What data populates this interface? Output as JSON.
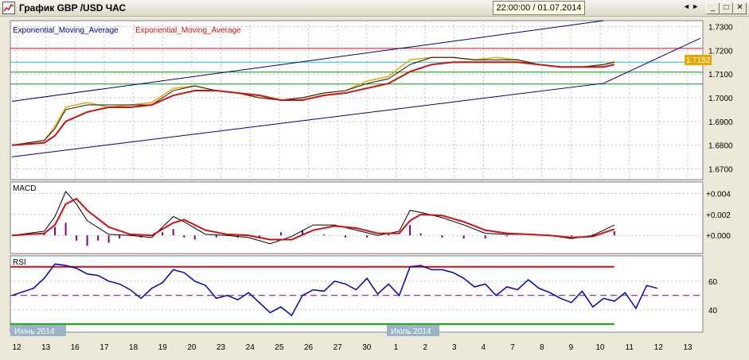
{
  "window": {
    "title": "График GBP /USD  ЧАС",
    "crosshair_time": "22:00:00 / 01.07.2014",
    "icons": {
      "app": "chart-app-icon",
      "minimize": "minimize-icon",
      "maximize": "maximize-icon",
      "close": "close-icon"
    },
    "buttons": {
      "minimize": "_",
      "maximize": "□",
      "close": "✕"
    },
    "nav_arrows": "◄ ►"
  },
  "colors": {
    "background": "#ffffff",
    "grid": "#c0c0c0",
    "price": "#e8a800",
    "ema_fast": "#1a1a1a",
    "ema_slow": "#d01010",
    "channel": "#000080",
    "resistance": "#d01010",
    "support": "#00a000",
    "cyan_level": "#20c0c0",
    "rsi_line": "#0000c0",
    "rsi_overbought": "#ff00ff",
    "macd_hist": "#800080",
    "current_price_label": "#e8a800"
  },
  "chart_data": [
    {
      "type": "line",
      "panel": "price",
      "legend": [
        "Exponential_Moving_Average",
        "Exponential_Moving_Average"
      ],
      "legend_colors": [
        "#000080",
        "#d01010"
      ],
      "ylim": [
        1.6665,
        1.7315
      ],
      "yticks": [
        "1.7300",
        "1.7200",
        "1.7100",
        "1.7000",
        "1.6900",
        "1.6800",
        "1.6700"
      ],
      "current_price": "1.7152",
      "hlines": {
        "resistance": 1.7208,
        "cyan": 1.715,
        "support_top": 1.7108,
        "support_bottom": 1.7058
      },
      "channel_upper": [
        [
          0,
          1.6985
        ],
        [
          55,
          1.7325
        ]
      ],
      "channel_lower": [
        [
          0,
          1.6751
        ],
        [
          55,
          1.7061
        ],
        [
          64,
          1.7251
        ]
      ],
      "price": [
        [
          0,
          1.68
        ],
        [
          3,
          1.682
        ],
        [
          4,
          1.688
        ],
        [
          5,
          1.696
        ],
        [
          7,
          1.698
        ],
        [
          9,
          1.696
        ],
        [
          11,
          1.697
        ],
        [
          13,
          1.698
        ],
        [
          15,
          1.704
        ],
        [
          17,
          1.705
        ],
        [
          19,
          1.703
        ],
        [
          21,
          1.702
        ],
        [
          23,
          1.7
        ],
        [
          25,
          1.699
        ],
        [
          27,
          1.7
        ],
        [
          29,
          1.702
        ],
        [
          31,
          1.703
        ],
        [
          33,
          1.707
        ],
        [
          35,
          1.709
        ],
        [
          37,
          1.716
        ],
        [
          39,
          1.717
        ],
        [
          41,
          1.717
        ],
        [
          43,
          1.716
        ],
        [
          45,
          1.717
        ],
        [
          47,
          1.716
        ],
        [
          49,
          1.714
        ],
        [
          51,
          1.713
        ],
        [
          53,
          1.713
        ],
        [
          55,
          1.714
        ],
        [
          56,
          1.7152
        ]
      ],
      "ema_fast": [
        [
          0,
          1.68
        ],
        [
          3,
          1.682
        ],
        [
          4,
          1.687
        ],
        [
          5,
          1.695
        ],
        [
          7,
          1.697
        ],
        [
          9,
          1.697
        ],
        [
          11,
          1.697
        ],
        [
          13,
          1.697
        ],
        [
          15,
          1.703
        ],
        [
          17,
          1.705
        ],
        [
          19,
          1.703
        ],
        [
          21,
          1.702
        ],
        [
          23,
          1.7
        ],
        [
          25,
          1.699
        ],
        [
          27,
          1.7
        ],
        [
          29,
          1.702
        ],
        [
          31,
          1.703
        ],
        [
          33,
          1.706
        ],
        [
          35,
          1.708
        ],
        [
          37,
          1.714
        ],
        [
          39,
          1.717
        ],
        [
          41,
          1.717
        ],
        [
          43,
          1.716
        ],
        [
          45,
          1.716
        ],
        [
          47,
          1.716
        ],
        [
          49,
          1.714
        ],
        [
          51,
          1.713
        ],
        [
          53,
          1.713
        ],
        [
          55,
          1.714
        ],
        [
          56,
          1.715
        ]
      ],
      "ema_slow": [
        [
          0,
          1.68
        ],
        [
          3,
          1.681
        ],
        [
          4,
          1.684
        ],
        [
          5,
          1.69
        ],
        [
          7,
          1.694
        ],
        [
          9,
          1.696
        ],
        [
          11,
          1.696
        ],
        [
          13,
          1.697
        ],
        [
          15,
          1.701
        ],
        [
          17,
          1.703
        ],
        [
          19,
          1.703
        ],
        [
          21,
          1.702
        ],
        [
          23,
          1.701
        ],
        [
          25,
          1.699
        ],
        [
          27,
          1.699
        ],
        [
          29,
          1.701
        ],
        [
          31,
          1.702
        ],
        [
          33,
          1.704
        ],
        [
          35,
          1.706
        ],
        [
          37,
          1.711
        ],
        [
          39,
          1.714
        ],
        [
          41,
          1.715
        ],
        [
          43,
          1.715
        ],
        [
          45,
          1.715
        ],
        [
          47,
          1.715
        ],
        [
          49,
          1.714
        ],
        [
          51,
          1.713
        ],
        [
          53,
          1.713
        ],
        [
          55,
          1.713
        ],
        [
          56,
          1.714
        ]
      ]
    },
    {
      "type": "line",
      "panel": "macd",
      "title": "MACD",
      "ylim": [
        -0.0015,
        0.0048
      ],
      "yticks": [
        "+0.004",
        "+0.002",
        "+0.000"
      ],
      "macd": [
        [
          0,
          0
        ],
        [
          3,
          0.0004
        ],
        [
          4,
          0.0018
        ],
        [
          5,
          0.0042
        ],
        [
          6,
          0.003
        ],
        [
          7,
          0.0014
        ],
        [
          9,
          0.0001
        ],
        [
          11,
          0
        ],
        [
          13,
          -0.0002
        ],
        [
          15,
          0.0018
        ],
        [
          16,
          0.0013
        ],
        [
          18,
          0.0001
        ],
        [
          20,
          0
        ],
        [
          22,
          -0.0002
        ],
        [
          24,
          -0.0008
        ],
        [
          26,
          -0.0001
        ],
        [
          28,
          0.001
        ],
        [
          30,
          0.001
        ],
        [
          32,
          0.0005
        ],
        [
          34,
          0
        ],
        [
          36,
          0.0004
        ],
        [
          37,
          0.0024
        ],
        [
          38,
          0.0022
        ],
        [
          40,
          0.0017
        ],
        [
          42,
          0.001
        ],
        [
          44,
          0.0002
        ],
        [
          46,
          0.0001
        ],
        [
          48,
          0.0001
        ],
        [
          50,
          0
        ],
        [
          52,
          -0.0003
        ],
        [
          54,
          0
        ],
        [
          56,
          0.001
        ]
      ],
      "signal": [
        [
          0,
          0
        ],
        [
          3,
          0.0002
        ],
        [
          4,
          0.001
        ],
        [
          5,
          0.003
        ],
        [
          6,
          0.0035
        ],
        [
          7,
          0.0024
        ],
        [
          9,
          0.0008
        ],
        [
          11,
          0.0001
        ],
        [
          13,
          0
        ],
        [
          15,
          0.0012
        ],
        [
          16,
          0.0015
        ],
        [
          18,
          0.0005
        ],
        [
          20,
          0.0001
        ],
        [
          22,
          0
        ],
        [
          24,
          -0.0004
        ],
        [
          26,
          -0.0004
        ],
        [
          28,
          0.0005
        ],
        [
          30,
          0.0009
        ],
        [
          32,
          0.0007
        ],
        [
          34,
          0.0002
        ],
        [
          36,
          0.0002
        ],
        [
          37,
          0.0014
        ],
        [
          38,
          0.002
        ],
        [
          40,
          0.0019
        ],
        [
          42,
          0.0013
        ],
        [
          44,
          0.0005
        ],
        [
          46,
          0.0002
        ],
        [
          48,
          0.0001
        ],
        [
          50,
          0
        ],
        [
          52,
          -0.0002
        ],
        [
          54,
          -0.0001
        ],
        [
          56,
          0.0006
        ]
      ],
      "histogram": [
        [
          3,
          0.0002
        ],
        [
          4,
          0.0008
        ],
        [
          5,
          0.0012
        ],
        [
          6,
          -0.0005
        ],
        [
          7,
          -0.001
        ],
        [
          8,
          -0.0005
        ],
        [
          9,
          -0.0007
        ],
        [
          10,
          -0.0003
        ],
        [
          12,
          -0.0002
        ],
        [
          14,
          0.0003
        ],
        [
          15,
          0.0006
        ],
        [
          16,
          -0.0002
        ],
        [
          17,
          -0.0004
        ],
        [
          19,
          -0.0002
        ],
        [
          21,
          -0.0002
        ],
        [
          23,
          -0.0003
        ],
        [
          25,
          0.0003
        ],
        [
          27,
          0.0005
        ],
        [
          29,
          0.0001
        ],
        [
          31,
          -0.0002
        ],
        [
          33,
          -0.0002
        ],
        [
          35,
          0.0002
        ],
        [
          37,
          0.001
        ],
        [
          38,
          0.0002
        ],
        [
          40,
          -0.0002
        ],
        [
          42,
          -0.0003
        ],
        [
          44,
          -0.0003
        ],
        [
          46,
          -0.0001
        ],
        [
          48,
          0
        ],
        [
          50,
          0
        ],
        [
          52,
          -0.0001
        ],
        [
          54,
          0.0001
        ],
        [
          56,
          0.0004
        ]
      ]
    },
    {
      "type": "line",
      "panel": "rsi",
      "title": "RSI",
      "ylim": [
        26,
        76
      ],
      "yticks": [
        "60",
        "40"
      ],
      "levels": {
        "overbought": 70,
        "middle": 50,
        "oversold": 30
      },
      "rsi": [
        [
          0,
          50
        ],
        [
          2,
          55
        ],
        [
          3,
          62
        ],
        [
          4,
          72
        ],
        [
          5,
          71
        ],
        [
          6,
          69
        ],
        [
          7,
          65
        ],
        [
          8,
          64
        ],
        [
          9,
          60
        ],
        [
          10,
          58
        ],
        [
          11,
          54
        ],
        [
          12,
          48
        ],
        [
          13,
          55
        ],
        [
          14,
          59
        ],
        [
          15,
          68
        ],
        [
          16,
          66
        ],
        [
          17,
          60
        ],
        [
          18,
          57
        ],
        [
          19,
          48
        ],
        [
          20,
          50
        ],
        [
          21,
          47
        ],
        [
          22,
          52
        ],
        [
          23,
          45
        ],
        [
          24,
          38
        ],
        [
          25,
          42
        ],
        [
          26,
          36
        ],
        [
          27,
          50
        ],
        [
          28,
          54
        ],
        [
          29,
          53
        ],
        [
          30,
          60
        ],
        [
          31,
          58
        ],
        [
          32,
          54
        ],
        [
          33,
          62
        ],
        [
          34,
          51
        ],
        [
          35,
          58
        ],
        [
          36,
          50
        ],
        [
          37,
          70
        ],
        [
          38,
          71
        ],
        [
          39,
          68
        ],
        [
          40,
          68
        ],
        [
          41,
          66
        ],
        [
          42,
          62
        ],
        [
          43,
          56
        ],
        [
          44,
          58
        ],
        [
          45,
          50
        ],
        [
          46,
          56
        ],
        [
          47,
          54
        ],
        [
          48,
          61
        ],
        [
          49,
          55
        ],
        [
          50,
          52
        ],
        [
          51,
          48
        ],
        [
          52,
          45
        ],
        [
          53,
          53
        ],
        [
          54,
          42
        ],
        [
          55,
          48
        ],
        [
          56,
          46
        ],
        [
          57,
          52
        ],
        [
          58,
          41
        ],
        [
          59,
          57
        ],
        [
          60,
          55
        ]
      ]
    }
  ],
  "x_axis": {
    "labels": [
      "12",
      "13",
      "16",
      "17",
      "18",
      "19",
      "20",
      "23",
      "24",
      "25",
      "26",
      "27",
      "30",
      "1",
      "2",
      "3",
      "4",
      "7",
      "8",
      "9",
      "10",
      "11",
      "12",
      "13"
    ],
    "month_labels": [
      "Июнь 2014",
      "Июль 2014"
    ]
  }
}
